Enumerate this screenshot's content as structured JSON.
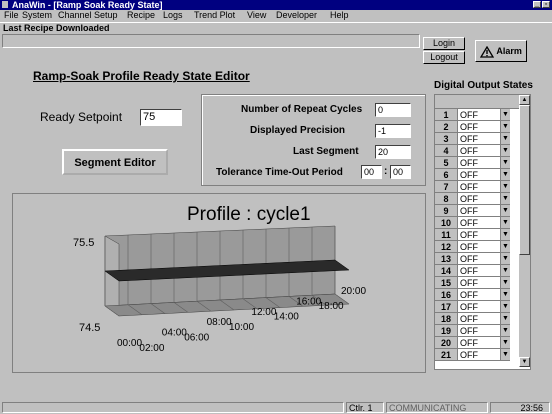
{
  "window": {
    "title": "AnaWin - [Ramp Soak Ready State]"
  },
  "menu": [
    "File",
    "System",
    "Channel Setup",
    "Recipe",
    "Logs",
    "Trend Plot",
    "View",
    "Developer",
    "Help"
  ],
  "recipe_bar": {
    "label": "Last Recipe Downloaded",
    "value": ""
  },
  "buttons": {
    "login": "Login",
    "logout": "Logout",
    "alarm": "Alarm",
    "segment_editor": "Segment Editor"
  },
  "editor": {
    "title": "Ramp-Soak Profile Ready State Editor",
    "ready_setpoint_label": "Ready Setpoint",
    "ready_setpoint_value": "75",
    "repeat_cycles_label": "Number of Repeat Cycles",
    "repeat_cycles_value": "0",
    "precision_label": "Displayed Precision",
    "precision_value": "-1",
    "last_segment_label": "Last Segment",
    "last_segment_value": "20",
    "tolerance_label": "Tolerance Time-Out Period",
    "tolerance_hh": "00",
    "tolerance_sep": ":",
    "tolerance_mm": "00"
  },
  "chart_data": {
    "type": "line",
    "title": "Profile : cycle1",
    "y_ticks": [
      "75.5",
      "74.5"
    ],
    "x_ticks": [
      "00:00",
      "02:00",
      "04:00",
      "06:00",
      "08:00",
      "10:00",
      "12:00",
      "14:00",
      "16:00",
      "18:00",
      "20:00"
    ],
    "series": [
      {
        "x": [
          "00:00",
          "20:00"
        ],
        "values": [
          75,
          75
        ]
      }
    ],
    "ylim": [
      74.5,
      75.5
    ],
    "style": "3d-ribbon"
  },
  "outputs": {
    "title": "Digital Output States",
    "rows": [
      {
        "n": "1",
        "v": "OFF"
      },
      {
        "n": "2",
        "v": "OFF"
      },
      {
        "n": "3",
        "v": "OFF"
      },
      {
        "n": "4",
        "v": "OFF"
      },
      {
        "n": "5",
        "v": "OFF"
      },
      {
        "n": "6",
        "v": "OFF"
      },
      {
        "n": "7",
        "v": "OFF"
      },
      {
        "n": "8",
        "v": "OFF"
      },
      {
        "n": "9",
        "v": "OFF"
      },
      {
        "n": "10",
        "v": "OFF"
      },
      {
        "n": "11",
        "v": "OFF"
      },
      {
        "n": "12",
        "v": "OFF"
      },
      {
        "n": "13",
        "v": "OFF"
      },
      {
        "n": "14",
        "v": "OFF"
      },
      {
        "n": "15",
        "v": "OFF"
      },
      {
        "n": "16",
        "v": "OFF"
      },
      {
        "n": "17",
        "v": "OFF"
      },
      {
        "n": "18",
        "v": "OFF"
      },
      {
        "n": "19",
        "v": "OFF"
      },
      {
        "n": "20",
        "v": "OFF"
      },
      {
        "n": "21",
        "v": "OFF"
      }
    ]
  },
  "status": {
    "controller": "Ctlr. 1",
    "state": "COMMUNICATING",
    "time": "23:56"
  },
  "icons": {
    "app": "app-icon",
    "warning": "warning-icon",
    "dropdown": "chevron-down-icon"
  },
  "colors": {
    "titlebar": "#000080",
    "face": "#c0c0c0",
    "chart_bg": "#c0c0c0"
  }
}
